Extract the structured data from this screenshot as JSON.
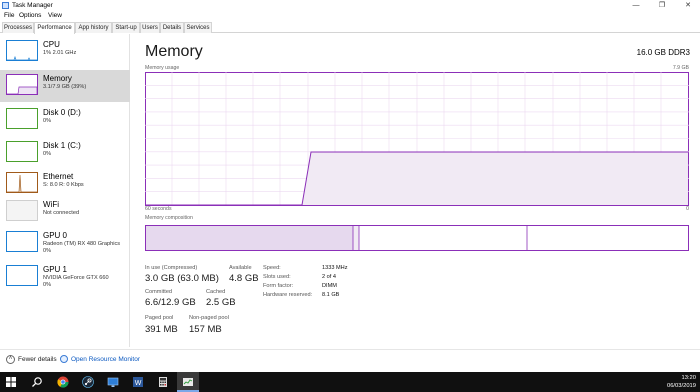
{
  "window": {
    "title": "Task Manager",
    "controls": {
      "minimize": "—",
      "maximize": "❐",
      "close": "✕"
    }
  },
  "menu": [
    "File",
    "Options",
    "View"
  ],
  "tabs": [
    "Processes",
    "Performance",
    "App history",
    "Start-up",
    "Users",
    "Details",
    "Services"
  ],
  "sidebar": [
    {
      "name": "CPU",
      "sub": "1% 2.01 GHz",
      "sub2": "",
      "color": "#1a7fd4"
    },
    {
      "name": "Memory",
      "sub": "3.1/7.9 GB (39%)",
      "sub2": "",
      "color": "#8b2fb8"
    },
    {
      "name": "Disk 0 (D:)",
      "sub": "0%",
      "sub2": "",
      "color": "#4aa02c"
    },
    {
      "name": "Disk 1 (C:)",
      "sub": "0%",
      "sub2": "",
      "color": "#4aa02c"
    },
    {
      "name": "Ethernet",
      "sub": "S: 8.0  R: 0 Kbps",
      "sub2": "",
      "color": "#a05a1a"
    },
    {
      "name": "WiFi",
      "sub": "Not connected",
      "sub2": "",
      "color": "#bbbbbb"
    },
    {
      "name": "GPU 0",
      "sub": "Radeon (TM) RX 480 Graphics",
      "sub2": "0%",
      "color": "#1a7fd4"
    },
    {
      "name": "GPU 1",
      "sub": "NVIDIA GeForce GTX 660",
      "sub2": "0%",
      "color": "#1a7fd4"
    }
  ],
  "main": {
    "title": "Memory",
    "spec": "16.0 GB DDR3",
    "usage_label": "Memory usage",
    "usage_max": "7.9 GB",
    "time_label": "60 seconds",
    "time_end": "0",
    "composition_label": "Memory composition",
    "usage_fraction": 0.39,
    "stats": {
      "in_use_label": "In use (Compressed)",
      "in_use_value": "3.0 GB (63.0 MB)",
      "available_label": "Available",
      "available_value": "4.8 GB",
      "committed_label": "Committed",
      "committed_value": "6.6/12.9 GB",
      "cached_label": "Cached",
      "cached_value": "2.5 GB",
      "paged_label": "Paged pool",
      "paged_value": "391 MB",
      "nonpaged_label": "Non-paged pool",
      "nonpaged_value": "157 MB"
    },
    "details": [
      {
        "label": "Speed:",
        "value": "1333 MHz"
      },
      {
        "label": "Slots used:",
        "value": "2 of 4"
      },
      {
        "label": "Form factor:",
        "value": "DIMM"
      },
      {
        "label": "Hardware reserved:",
        "value": "8.1 GB"
      }
    ],
    "accent": "#8b2fb8"
  },
  "footer": {
    "fewer_details": "Fewer details",
    "open_resource_monitor": "Open Resource Monitor"
  },
  "taskbar": {
    "icons": [
      "windows-start-icon",
      "search-icon",
      "chrome-icon",
      "steam-icon",
      "monitor-icon",
      "word-icon",
      "calculator-icon",
      "task-manager-icon"
    ],
    "time": "13:20",
    "date": "06/03/2019"
  }
}
